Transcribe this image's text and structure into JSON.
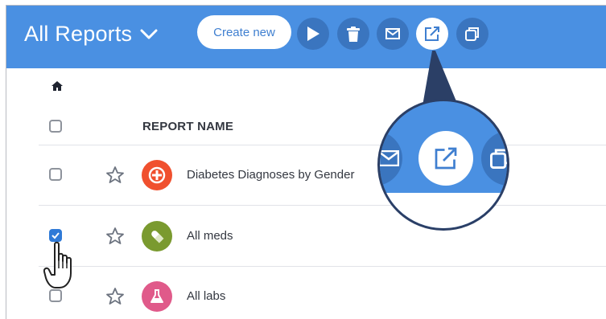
{
  "header": {
    "title": "All Reports",
    "create_label": "Create new",
    "toolbar": [
      {
        "icon": "play-icon",
        "active": false
      },
      {
        "icon": "trash-icon",
        "active": false
      },
      {
        "icon": "mail-icon",
        "active": false
      },
      {
        "icon": "export-icon",
        "active": true
      },
      {
        "icon": "copy-icon",
        "active": false
      }
    ]
  },
  "breadcrumb": {
    "icon": "home-icon"
  },
  "table": {
    "column_header": "REPORT NAME",
    "rows": [
      {
        "name": "Diabetes Diagnoses by Gender",
        "icon": "plus-circle-icon",
        "icon_color": "#f0502e",
        "checked": false
      },
      {
        "name": "All meds",
        "icon": "pill-icon",
        "icon_color": "#7a9a2f",
        "checked": true
      },
      {
        "name": "All labs",
        "icon": "flask-icon",
        "icon_color": "#e05a8a",
        "checked": false
      }
    ]
  },
  "colors": {
    "header": "#4a90e2",
    "toolbar_button": "#3a75bf",
    "checkbox_checked": "#2f7ad7",
    "magnifier_border": "#2b3f66"
  }
}
